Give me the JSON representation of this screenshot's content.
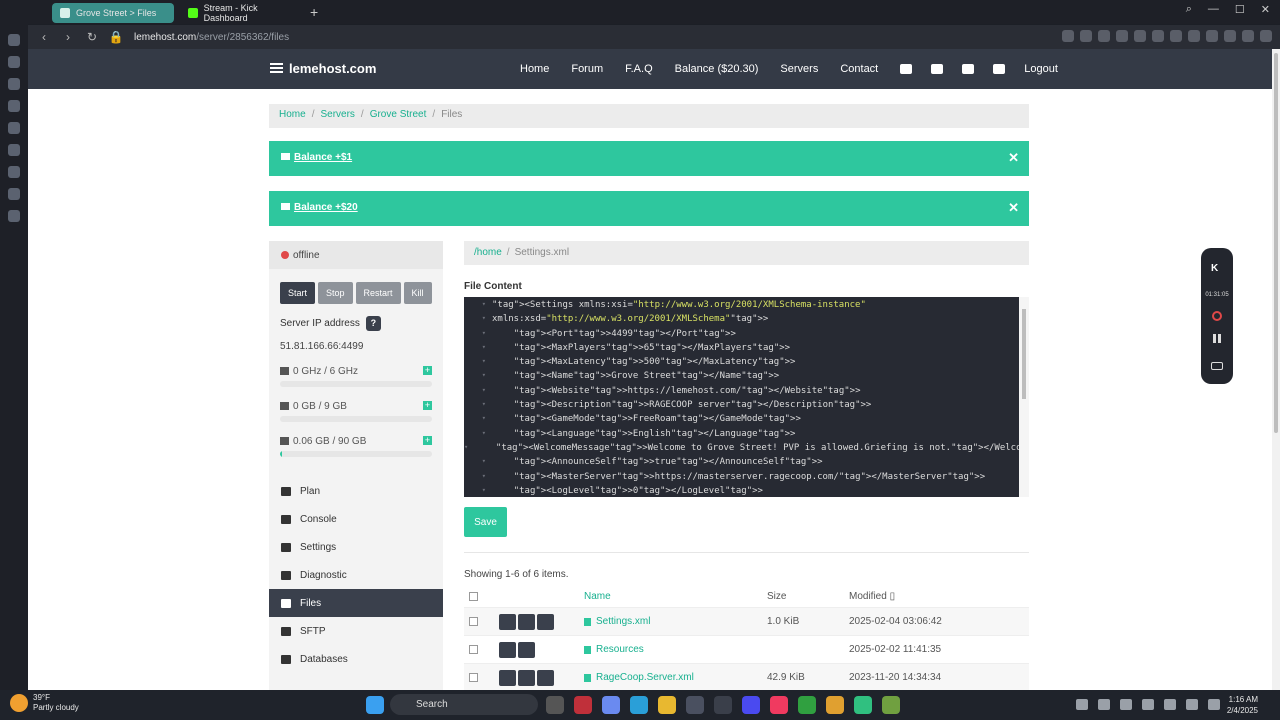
{
  "browser": {
    "tabs": [
      {
        "label": "Grove Street > Files",
        "active": true
      },
      {
        "label": "Stream - Kick Dashboard",
        "active": false
      }
    ],
    "url_host": "lemehost.com",
    "url_path": "/server/2856362/files"
  },
  "site": {
    "brand": "lemehost.com",
    "nav": [
      "Home",
      "Forum",
      "F.A.Q",
      "Balance ($20.30)",
      "Servers",
      "Contact",
      "Logout"
    ]
  },
  "breadcrumb": [
    "Home",
    "Servers",
    "Grove Street",
    "Files"
  ],
  "alerts": [
    "Balance +$1",
    "Balance +$20"
  ],
  "server": {
    "status": "offline",
    "buttons": [
      "Start",
      "Stop",
      "Restart",
      "Kill"
    ],
    "ip_label": "Server IP address",
    "ip": "51.81.166.66:4499",
    "resources": [
      {
        "label": "0 GHz / 6 GHz",
        "fill": 0
      },
      {
        "label": "0 GB / 9 GB",
        "fill": 0
      },
      {
        "label": "0.06 GB / 90 GB",
        "fill": 0.001
      }
    ],
    "menu": [
      "Plan",
      "Console",
      "Settings",
      "Diagnostic",
      "Files",
      "SFTP",
      "Databases"
    ],
    "active_menu": "Files"
  },
  "path": {
    "root": "/home",
    "file": "Settings.xml"
  },
  "file_content_label": "File Content",
  "editor_lines": [
    {
      "i": "",
      "t": "<Settings xmlns:xsi=\"http://www.w3.org/2001/XMLSchema-instance\""
    },
    {
      "i": "",
      "t": "xmlns:xsd=\"http://www.w3.org/2001/XMLSchema\">"
    },
    {
      "i": "    ",
      "t": "<Port>4499</Port>"
    },
    {
      "i": "    ",
      "t": "<MaxPlayers>65</MaxPlayers>"
    },
    {
      "i": "    ",
      "t": "<MaxLatency>500</MaxLatency>"
    },
    {
      "i": "    ",
      "t": "<Name>Grove Street</Name>"
    },
    {
      "i": "    ",
      "t": "<Website>https://lemehost.com/</Website>"
    },
    {
      "i": "    ",
      "t": "<Description>RAGECOOP server</Description>"
    },
    {
      "i": "    ",
      "t": "<GameMode>FreeRoam</GameMode>"
    },
    {
      "i": "    ",
      "t": "<Language>English</Language>"
    },
    {
      "i": "    ",
      "t": "<WelcomeMessage>Welcome to Grove Street! PVP is allowed.Griefing is not.</WelcomeMessage>"
    },
    {
      "i": "    ",
      "t": "<AnnounceSelf>true</AnnounceSelf>"
    },
    {
      "i": "    ",
      "t": "<MasterServer>https://masterserver.ragecoop.com/</MasterServer>"
    },
    {
      "i": "    ",
      "t": "<LogLevel>0</LogLevel>"
    }
  ],
  "save_label": "Save",
  "showing": "Showing 1-6 of 6 items.",
  "table": {
    "headers": {
      "name": "Name",
      "size": "Size",
      "modified": "Modified"
    },
    "rows": [
      {
        "name": "Settings.xml",
        "size": "1.0 KiB",
        "modified": "2025-02-04 03:06:42",
        "actions": 3
      },
      {
        "name": "Resources",
        "size": "",
        "modified": "2025-02-02 11:41:35",
        "actions": 2
      },
      {
        "name": "RageCoop.Server.xml",
        "size": "42.9 KiB",
        "modified": "2023-11-20 14:34:34",
        "actions": 3
      }
    ]
  },
  "recorder": {
    "time": "01:31:05"
  },
  "taskbar": {
    "temp": "39°F",
    "weather": "Partly cloudy",
    "search": "Search",
    "time": "1:16 AM",
    "date": "2/4/2025"
  },
  "colors": {
    "accent": "#2ec79e",
    "nav": "#343a46",
    "link": "#18b08f"
  }
}
